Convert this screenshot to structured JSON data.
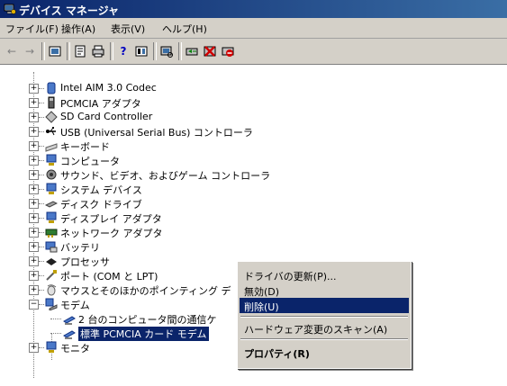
{
  "window": {
    "title": "デバイス マネージャ",
    "icon": "device-manager-icon"
  },
  "menu": [
    "ファイル(F)",
    "操作(A)",
    "表示(V)",
    "ヘルプ(H)"
  ],
  "toolbar": {
    "buttons": [
      "back-arrow-icon",
      "forward-arrow-icon",
      "view-icon",
      "properties-icon",
      "print-icon",
      "help-icon",
      "view2-icon",
      "scan-icon",
      "update-driver-icon",
      "uninstall-icon",
      "disable-icon"
    ]
  },
  "tree": {
    "items": [
      {
        "label": "Intel AIM 3.0 Codec",
        "icon": "audio-device-icon"
      },
      {
        "label": "PCMCIA アダプタ",
        "icon": "pcmcia-icon"
      },
      {
        "label": "SD Card Controller",
        "icon": "sd-card-icon"
      },
      {
        "label": "USB (Universal Serial Bus) コントローラ",
        "icon": "usb-icon"
      },
      {
        "label": "キーボード",
        "icon": "keyboard-icon"
      },
      {
        "label": "コンピュータ",
        "icon": "computer-icon"
      },
      {
        "label": "サウンド、ビデオ、およびゲーム コントローラ",
        "icon": "sound-icon"
      },
      {
        "label": "システム デバイス",
        "icon": "system-device-icon"
      },
      {
        "label": "ディスク ドライブ",
        "icon": "disk-drive-icon"
      },
      {
        "label": "ディスプレイ アダプタ",
        "icon": "display-adapter-icon"
      },
      {
        "label": "ネットワーク アダプタ",
        "icon": "network-adapter-icon"
      },
      {
        "label": "バッテリ",
        "icon": "battery-icon"
      },
      {
        "label": "プロセッサ",
        "icon": "processor-icon"
      },
      {
        "label": "ポート (COM と LPT)",
        "icon": "port-icon"
      },
      {
        "label": "マウスとそのほかのポインティング デ",
        "icon": "mouse-icon"
      },
      {
        "label": "モデム",
        "icon": "modem-icon"
      }
    ],
    "modem_children": [
      {
        "label": "2 台のコンピュータ間の通信ケ",
        "icon": "modem-device-icon"
      },
      {
        "label": "標準 PCMCIA カード モデム",
        "icon": "modem-device-icon"
      }
    ],
    "last_item": {
      "label": "モニタ",
      "icon": "monitor-icon"
    }
  },
  "context_menu": {
    "items": [
      {
        "label": "ドライバの更新(P)..."
      },
      {
        "label": "無効(D)"
      },
      {
        "label": "削除(U)"
      },
      {
        "label": "ハードウェア変更のスキャン(A)"
      },
      {
        "label": "プロパティ(R)"
      }
    ]
  },
  "colors": {
    "titlebar": "#0a246a",
    "highlight": "#0a246a",
    "chrome": "#d4d0c8"
  }
}
